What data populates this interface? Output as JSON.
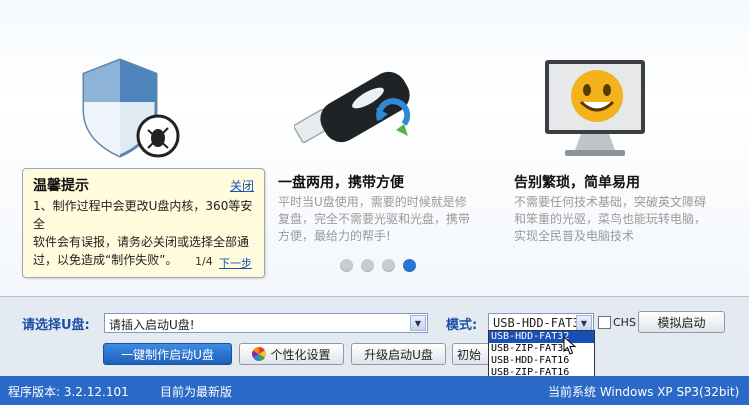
{
  "features": [
    {
      "title": "一盘两用，携带方便",
      "desc": [
        "平时当U盘使用，需要的时候就是修",
        "复盘，完全不需要光驱和光盘，携带",
        "方便，最给力的帮手!"
      ]
    },
    {
      "title": "告别繁琐，简单易用",
      "desc": [
        "不需要任何技术基础，突破英文障碍",
        "和笨重的光驱，菜鸟也能玩转电脑，",
        "实现全民普及电脑技术"
      ]
    }
  ],
  "tip": {
    "title": "温馨提示",
    "close": "关闭",
    "lines": [
      "1、制作过程中会更改U盘内核，360等安全",
      "软件会有误报，请务必关闭或选择全部通",
      "过，以免造成“制作失败”。"
    ],
    "page": "1/4",
    "next": "下一步"
  },
  "form": {
    "select_label": "请选择U盘:",
    "select_value": "请插入启动U盘!",
    "mode_label": "模式:",
    "mode_value": "USB-HDD-FAT32",
    "chs_label": "CHS",
    "simulate_button": "模拟启动"
  },
  "mode_options": [
    "USB-HDD-FAT32",
    "USB-ZIP-FAT32",
    "USB-HDD-FAT16",
    "USB-ZIP-FAT16"
  ],
  "actions": {
    "make": "一键制作启动U盘",
    "personalize": "个性化设置",
    "upgrade": "升级启动U盘",
    "init": "初始"
  },
  "status": {
    "version": "程序版本: 3.2.12.101",
    "latest": "目前为最新版",
    "system": "当前系统 Windows XP SP3(32bit)"
  },
  "icons": [
    "shield-bug-icon",
    "usb-drive-icon",
    "monitor-smile-icon",
    "color-wheel-icon",
    "cursor-icon"
  ],
  "colors": {
    "accent": "#2a69c5",
    "link": "#1a4fb8",
    "active_dot": "#2876d6"
  }
}
